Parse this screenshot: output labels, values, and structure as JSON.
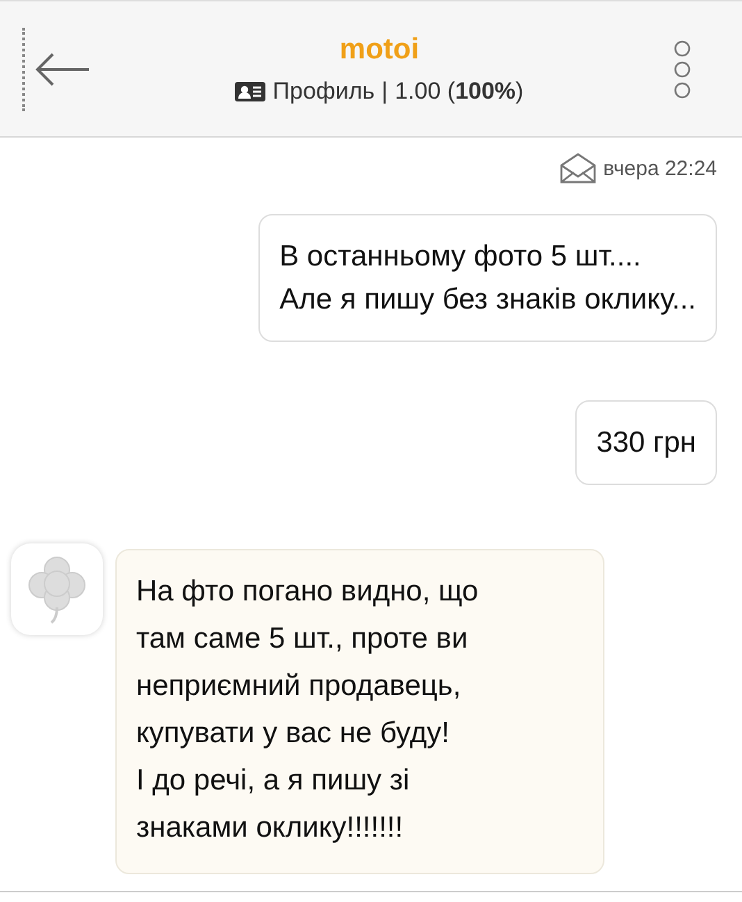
{
  "header": {
    "title": "motoi",
    "profile_link": "Профиль",
    "separator": "|",
    "rating": "1.00 (**100%**)"
  },
  "timestamp": "вчера 22:24",
  "messages": [
    {
      "kind": "outgoing",
      "text": "В останньому фото 5 шт....\nАле я пишу без знаків оклику..."
    },
    {
      "kind": "outgoing",
      "text": "330 грн"
    },
    {
      "kind": "incoming",
      "text": "На фто погано видно, що\nтам саме 5 шт., проте ви\nнеприємний продавець,\nкупувати у вас не буду!\nІ до речі, а я пишу зі\nзнаками оклику!!!!!!!"
    }
  ]
}
